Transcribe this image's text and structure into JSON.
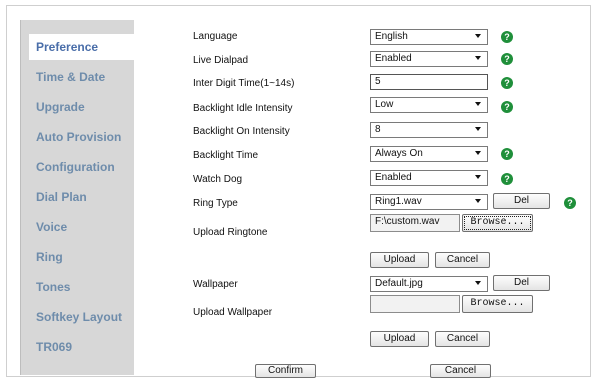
{
  "sidebar": {
    "items": [
      {
        "label": "Preference",
        "active": true
      },
      {
        "label": "Time & Date"
      },
      {
        "label": "Upgrade"
      },
      {
        "label": "Auto Provision"
      },
      {
        "label": "Configuration"
      },
      {
        "label": "Dial Plan"
      },
      {
        "label": "Voice"
      },
      {
        "label": "Ring"
      },
      {
        "label": "Tones"
      },
      {
        "label": "Softkey Layout"
      },
      {
        "label": "TR069"
      }
    ]
  },
  "form": {
    "language": {
      "label": "Language",
      "value": "English"
    },
    "live_dialpad": {
      "label": "Live Dialpad",
      "value": "Enabled"
    },
    "inter_digit_time": {
      "label": "Inter Digit Time(1~14s)",
      "value": "5"
    },
    "backlight_idle": {
      "label": "Backlight Idle Intensity",
      "value": "Low"
    },
    "backlight_on": {
      "label": "Backlight On Intensity",
      "value": "8"
    },
    "backlight_time": {
      "label": "Backlight Time",
      "value": "Always On"
    },
    "watch_dog": {
      "label": "Watch Dog",
      "value": "Enabled"
    },
    "ring_type": {
      "label": "Ring Type",
      "value": "Ring1.wav",
      "del_label": "Del"
    },
    "upload_ringtone": {
      "label": "Upload Ringtone",
      "file_value": "F:\\custom.wav",
      "browse_label": "Browse...",
      "upload_label": "Upload",
      "cancel_label": "Cancel"
    },
    "wallpaper": {
      "label": "Wallpaper",
      "value": "Default.jpg",
      "del_label": "Del"
    },
    "upload_wallpaper": {
      "label": "Upload Wallpaper",
      "file_value": "",
      "browse_label": "Browse...",
      "upload_label": "Upload",
      "cancel_label": "Cancel"
    }
  },
  "footer": {
    "confirm_label": "Confirm",
    "cancel_label": "Cancel"
  },
  "help_icon_glyph": "?",
  "colors": {
    "sidebar_bg": "#d7d7d7",
    "nav_text": "#6e8cab",
    "active_nav_text": "#4a6ea9",
    "help_icon": "#1f8f3a"
  }
}
